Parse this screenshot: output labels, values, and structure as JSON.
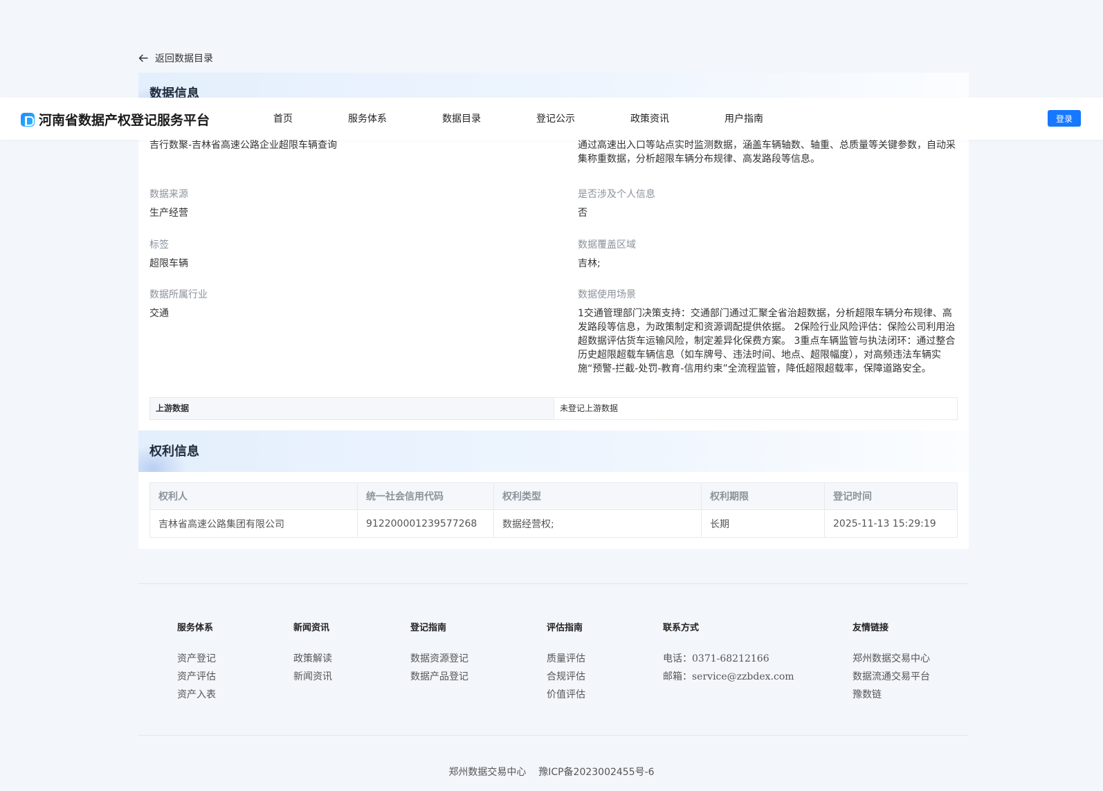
{
  "back_label": "返回数据目录",
  "nav": {
    "brand": "河南省数据产权登记服务平台",
    "items": [
      "首页",
      "服务体系",
      "数据目录",
      "登记公示",
      "政策资讯",
      "用户指南"
    ],
    "login": "登录"
  },
  "data_info": {
    "title": "数据信息",
    "name_value": "吉行数聚-吉林省高速公路企业超限车辆查询",
    "description_value": "通过高速出入口等站点实时监测数据，涵盖车辆轴数、轴重、总质量等关键参数，自动采集称重数据，分析超限车辆分布规律、高发路段等信息。",
    "fields_left": [
      {
        "label": "数据来源",
        "value": "生产经营"
      },
      {
        "label": "标签",
        "value": "超限车辆"
      },
      {
        "label": "数据所属行业",
        "value": "交通"
      }
    ],
    "fields_right": [
      {
        "label": "是否涉及个人信息",
        "value": "否"
      },
      {
        "label": "数据覆盖区域",
        "value": "吉林;"
      },
      {
        "label": "数据使用场景",
        "value": "1交通管理部门决策支持：交通部门通过汇聚全省治超数据，分析超限车辆分布规律、高发路段等信息，为政策制定和资源调配提供依据。 2保险行业风险评估：保险公司利用治超数据评估货车运输风险，制定差异化保费方案。 3重点车辆监管与执法闭环：通过整合历史超限超载车辆信息（如车牌号、违法时间、地点、超限幅度），对高频违法车辆实施“预警-拦截-处罚-教育-信用约束”全流程监管，降低超限超载率，保障道路安全。"
      }
    ],
    "upstream_label": "上游数据",
    "upstream_value": "未登记上游数据"
  },
  "rights_info": {
    "title": "权利信息",
    "columns": [
      "权利人",
      "统一社会信用代码",
      "权利类型",
      "权利期限",
      "登记时间"
    ],
    "rows": [
      [
        "吉林省高速公路集团有限公司",
        "912200001239577268",
        "数据经营权;",
        "长期",
        "2025-11-13 15:29:19"
      ]
    ]
  },
  "footer": {
    "service": {
      "title": "服务体系",
      "items": [
        "资产登记",
        "资产评估",
        "资产入表"
      ]
    },
    "news": {
      "title": "新闻资讯",
      "items": [
        "政策解读",
        "新闻资讯"
      ]
    },
    "register": {
      "title": "登记指南",
      "items": [
        "数据资源登记",
        "数据产品登记"
      ]
    },
    "evaluate": {
      "title": "评估指南",
      "items": [
        "质量评估",
        "合规评估",
        "价值评估"
      ]
    },
    "contact": {
      "title": "联系方式",
      "items": [
        "电话：0371-68212166",
        "邮箱：service@zzbdex.com"
      ]
    },
    "links": {
      "title": "友情链接",
      "items": [
        "郑州数据交易中心",
        "数据流通交易平台",
        "豫数链"
      ]
    },
    "copyright": "郑州数据交易中心    豫ICP备2023002455号-6"
  },
  "colors": {
    "primary": "#1677ff",
    "background": "#f3f6fb"
  }
}
